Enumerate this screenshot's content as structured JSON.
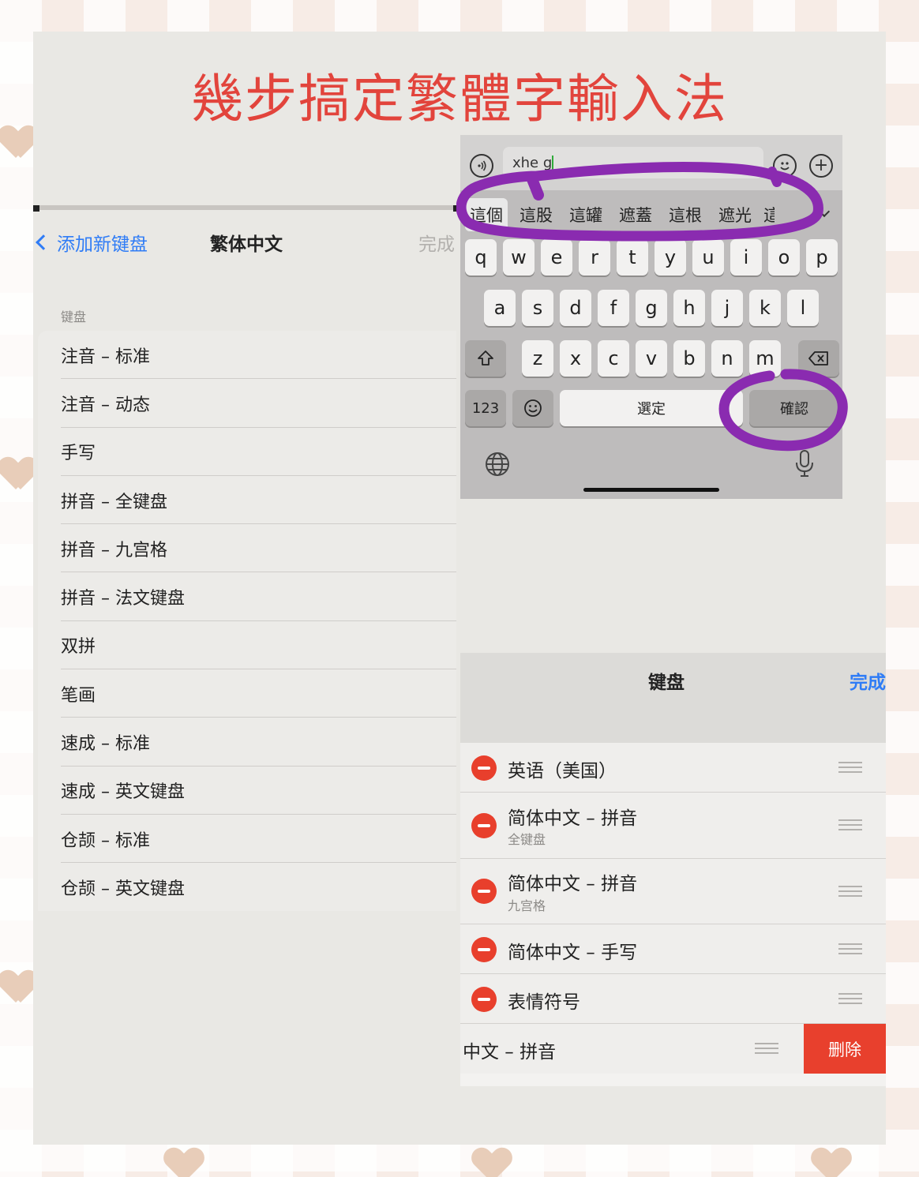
{
  "title": "幾步搞定繁體字輸入法",
  "left_panel": {
    "back_label": "添加新键盘",
    "title": "繁体中文",
    "done_label": "完成",
    "section_label": "键盘",
    "items": [
      "注音 – 标准",
      "注音 – 动态",
      "手写",
      "拼音 – 全键盘",
      "拼音 – 九宫格",
      "拼音 – 法文键盘",
      "双拼",
      "笔画",
      "速成 – 标准",
      "速成 – 英文键盘",
      "仓颉 – 标准",
      "仓颉 – 英文键盘"
    ]
  },
  "keyboard": {
    "input_text": "xhe g",
    "candidates": [
      "這個",
      "這股",
      "這罐",
      "遮蓋",
      "這根",
      "遮光",
      "這"
    ],
    "row1": [
      "q",
      "w",
      "e",
      "r",
      "t",
      "y",
      "u",
      "i",
      "o",
      "p"
    ],
    "row2": [
      "a",
      "s",
      "d",
      "f",
      "g",
      "h",
      "j",
      "k",
      "l"
    ],
    "row3": [
      "z",
      "x",
      "c",
      "v",
      "b",
      "n",
      "m"
    ],
    "num_key": "123",
    "space_label": "選定",
    "confirm_label": "確認",
    "icons": {
      "voice": "speaker-icon",
      "emoji": "emoji-icon",
      "plus": "plus-icon",
      "shift": "shift-icon",
      "delete": "backspace-icon",
      "globe": "globe-icon",
      "mic": "microphone-icon"
    }
  },
  "right_panel": {
    "title": "键盘",
    "done_label": "完成",
    "items": [
      {
        "name": "英语（美国）",
        "sub": ""
      },
      {
        "name": "简体中文 – 拼音",
        "sub": "全键盘"
      },
      {
        "name": "简体中文 – 拼音",
        "sub": "九宫格"
      },
      {
        "name": "简体中文 – 手写",
        "sub": ""
      },
      {
        "name": "表情符号",
        "sub": ""
      }
    ],
    "swiped_item": "中文 – 拼音",
    "delete_label": "删除"
  },
  "colors": {
    "title_red": "#e2443c",
    "link_blue": "#2f7cf6",
    "delete_red": "#e8402d",
    "highlight_purple": "#8a2bb0"
  }
}
